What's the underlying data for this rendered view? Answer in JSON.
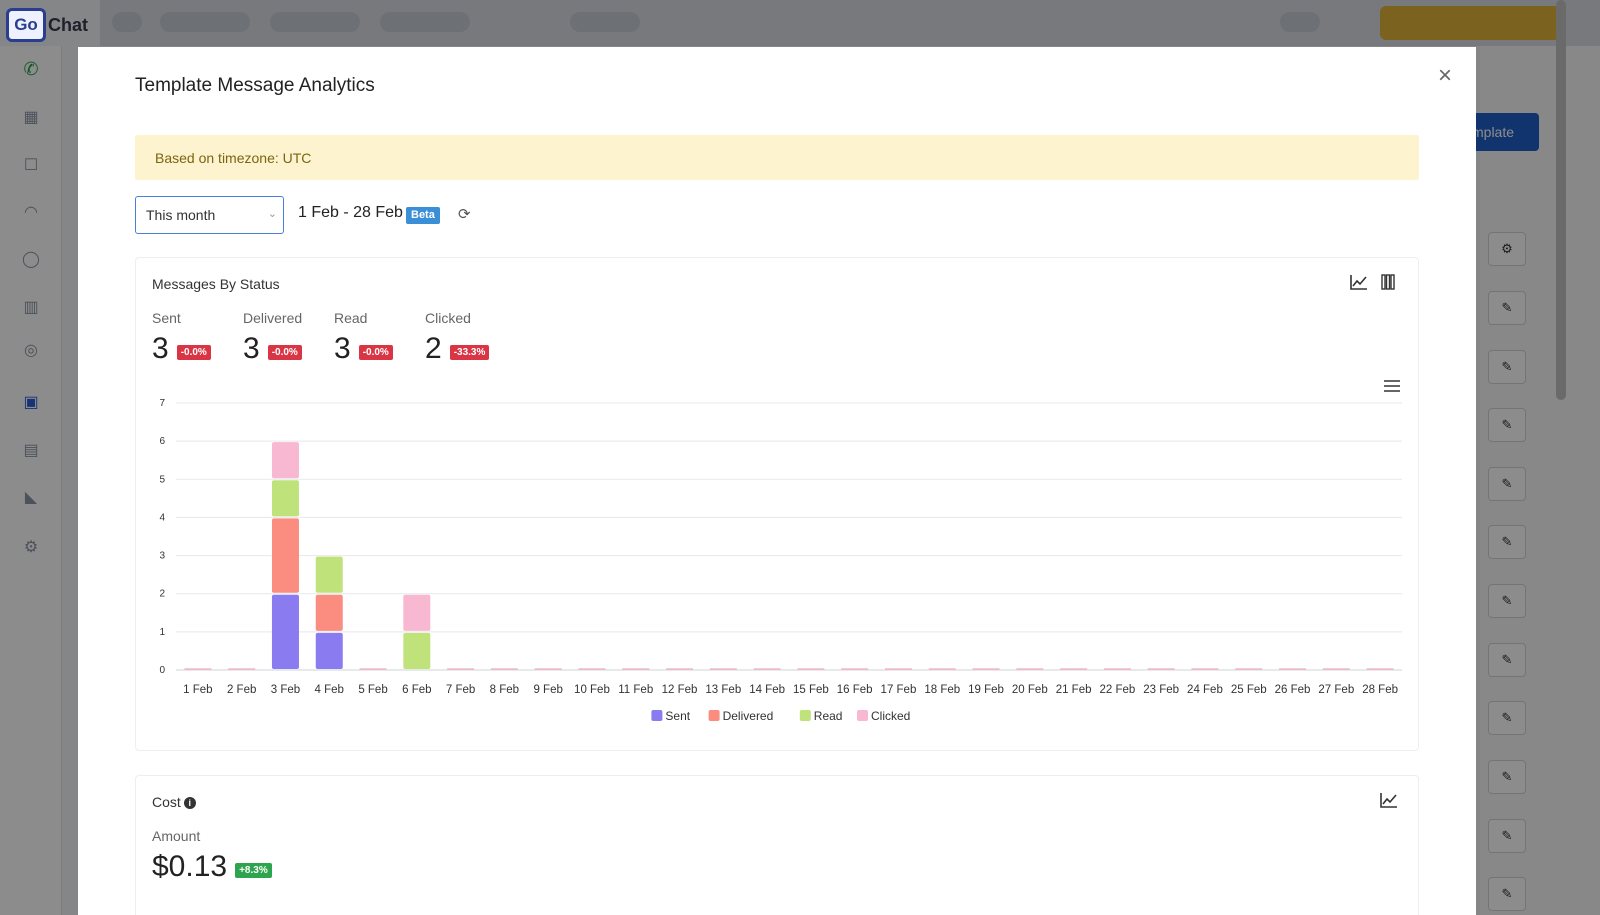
{
  "app": {
    "logo_prefix": "Go",
    "logo_suffix": "Chat",
    "new_template_button": "mplate"
  },
  "modal": {
    "title": "Template Message Analytics",
    "timezone_banner": "Based on timezone: UTC",
    "range_select": {
      "value": "This month"
    },
    "range_text": "1 Feb - 28 Feb",
    "beta_badge": "Beta"
  },
  "status_card": {
    "title": "Messages By Status",
    "stats": [
      {
        "label": "Sent",
        "value": "3",
        "change": "-0.0%"
      },
      {
        "label": "Delivered",
        "value": "3",
        "change": "-0.0%"
      },
      {
        "label": "Read",
        "value": "3",
        "change": "-0.0%"
      },
      {
        "label": "Clicked",
        "value": "2",
        "change": "-33.3%"
      }
    ]
  },
  "cost_card": {
    "title": "Cost",
    "amount_label": "Amount",
    "amount_value": "$0.13",
    "change": "+8.3%"
  },
  "colors": {
    "sent": "#8a7cf0",
    "delivered": "#fb8d80",
    "read": "#bfe37a",
    "clicked": "#f9b8d2"
  },
  "chart_data": {
    "type": "bar",
    "stacked": true,
    "categories": [
      "1 Feb",
      "2 Feb",
      "3 Feb",
      "4 Feb",
      "5 Feb",
      "6 Feb",
      "7 Feb",
      "8 Feb",
      "9 Feb",
      "10 Feb",
      "11 Feb",
      "12 Feb",
      "13 Feb",
      "14 Feb",
      "15 Feb",
      "16 Feb",
      "17 Feb",
      "18 Feb",
      "19 Feb",
      "20 Feb",
      "21 Feb",
      "22 Feb",
      "23 Feb",
      "24 Feb",
      "25 Feb",
      "26 Feb",
      "27 Feb",
      "28 Feb"
    ],
    "series": [
      {
        "name": "Sent",
        "values": [
          0,
          0,
          2,
          1,
          0,
          0,
          0,
          0,
          0,
          0,
          0,
          0,
          0,
          0,
          0,
          0,
          0,
          0,
          0,
          0,
          0,
          0,
          0,
          0,
          0,
          0,
          0,
          0
        ]
      },
      {
        "name": "Delivered",
        "values": [
          0,
          0,
          2,
          1,
          0,
          0,
          0,
          0,
          0,
          0,
          0,
          0,
          0,
          0,
          0,
          0,
          0,
          0,
          0,
          0,
          0,
          0,
          0,
          0,
          0,
          0,
          0,
          0
        ]
      },
      {
        "name": "Read",
        "values": [
          0,
          0,
          1,
          1,
          0,
          1,
          0,
          0,
          0,
          0,
          0,
          0,
          0,
          0,
          0,
          0,
          0,
          0,
          0,
          0,
          0,
          0,
          0,
          0,
          0,
          0,
          0,
          0
        ]
      },
      {
        "name": "Clicked",
        "values": [
          0,
          0,
          1,
          0,
          0,
          1,
          0,
          0,
          0,
          0,
          0,
          0,
          0,
          0,
          0,
          0,
          0,
          0,
          0,
          0,
          0,
          0,
          0,
          0,
          0,
          0,
          0,
          0
        ]
      }
    ],
    "ylim": [
      0,
      7
    ],
    "yticks": [
      0,
      1,
      2,
      3,
      4,
      5,
      6,
      7
    ],
    "grid": true,
    "legend": "bottom"
  }
}
